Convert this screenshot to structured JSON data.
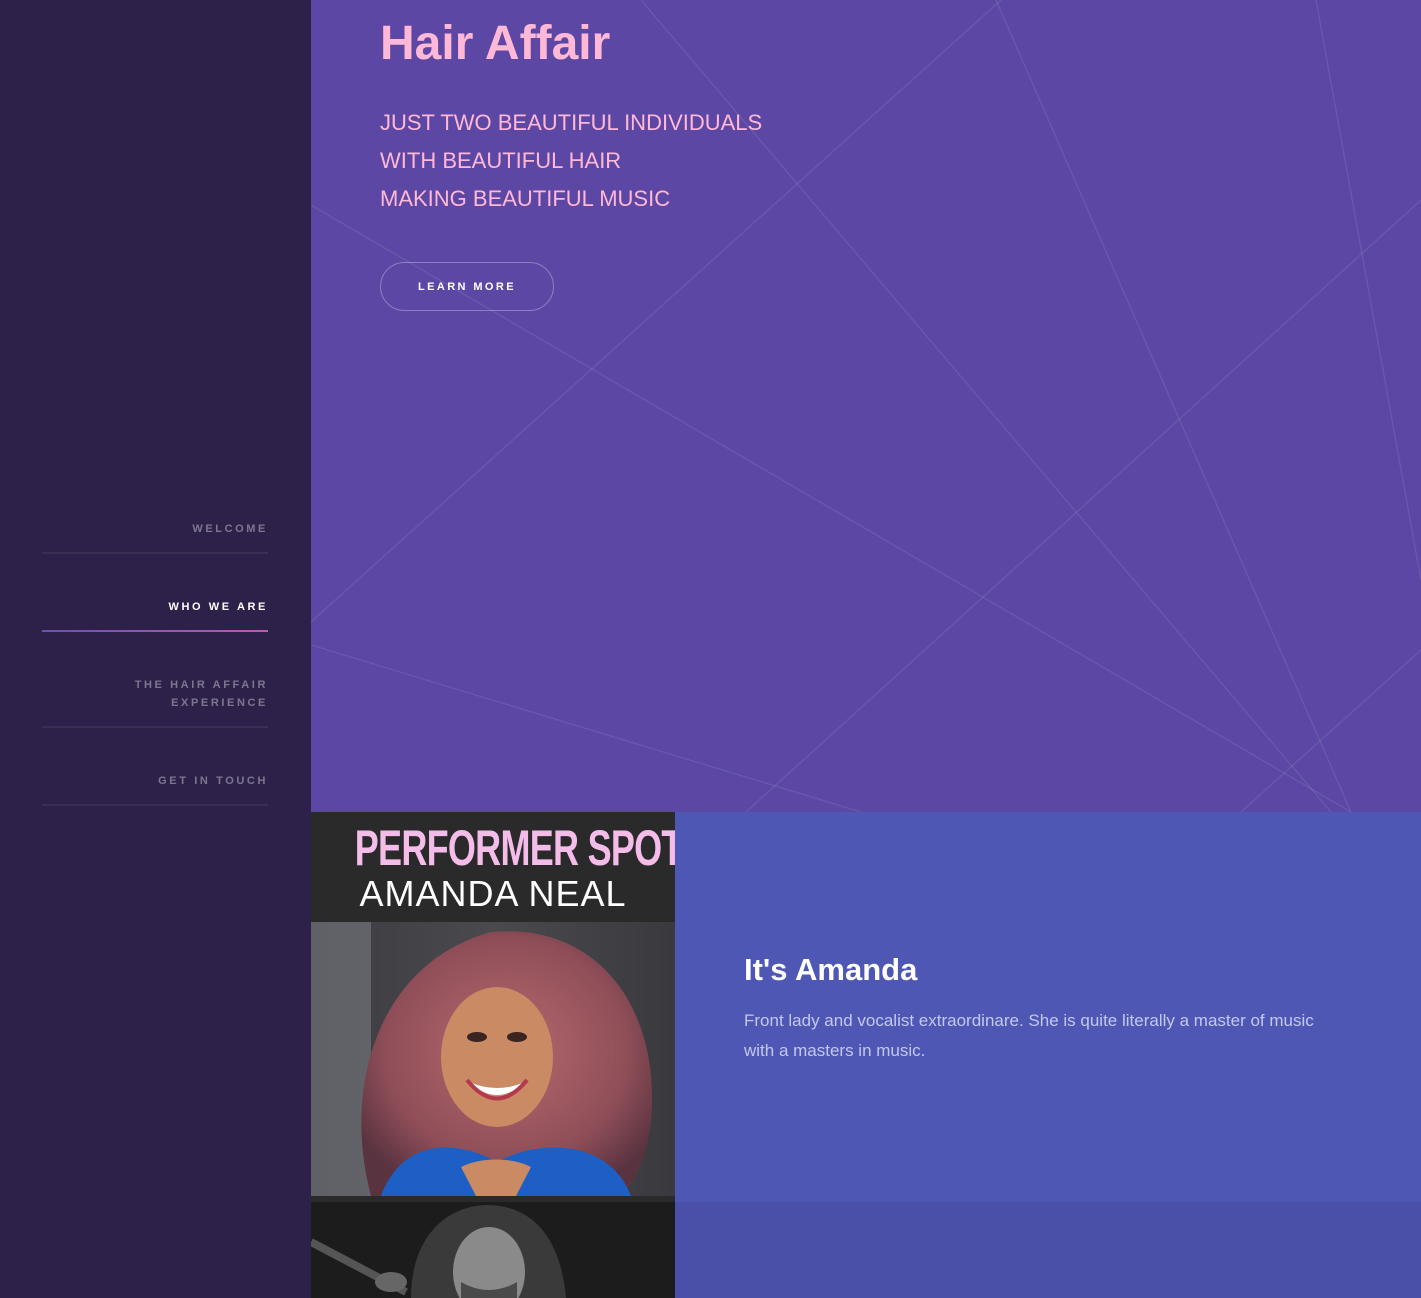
{
  "nav": {
    "items": [
      {
        "label": "WELCOME"
      },
      {
        "label": "WHO WE ARE"
      },
      {
        "label_line1": "THE HAIR AFFAIR",
        "label_line2": "EXPERIENCE"
      },
      {
        "label": "GET IN TOUCH"
      }
    ],
    "active": "WHO WE ARE"
  },
  "hero": {
    "title": "Hair Affair",
    "tagline": [
      "JUST TWO BEAUTIFUL INDIVIDUALS",
      "WITH BEAUTIFUL HAIR",
      "MAKING BEAUTIFUL MUSIC"
    ],
    "button_label": "LEARN MORE"
  },
  "spotlight": {
    "poster_title": "PERFORMER SPOTLIGHT",
    "poster_name": "AMANDA NEAL",
    "title": "It's Amanda",
    "description": "Front lady and vocalist extraordinare. She is quite literally a master of music with a masters in music."
  },
  "colors": {
    "sidebar": "#2e2149",
    "hero_bg": "#5c48a4",
    "accent_pink": "#ffb8d6",
    "spotlight_bg": "#4f57b4"
  }
}
